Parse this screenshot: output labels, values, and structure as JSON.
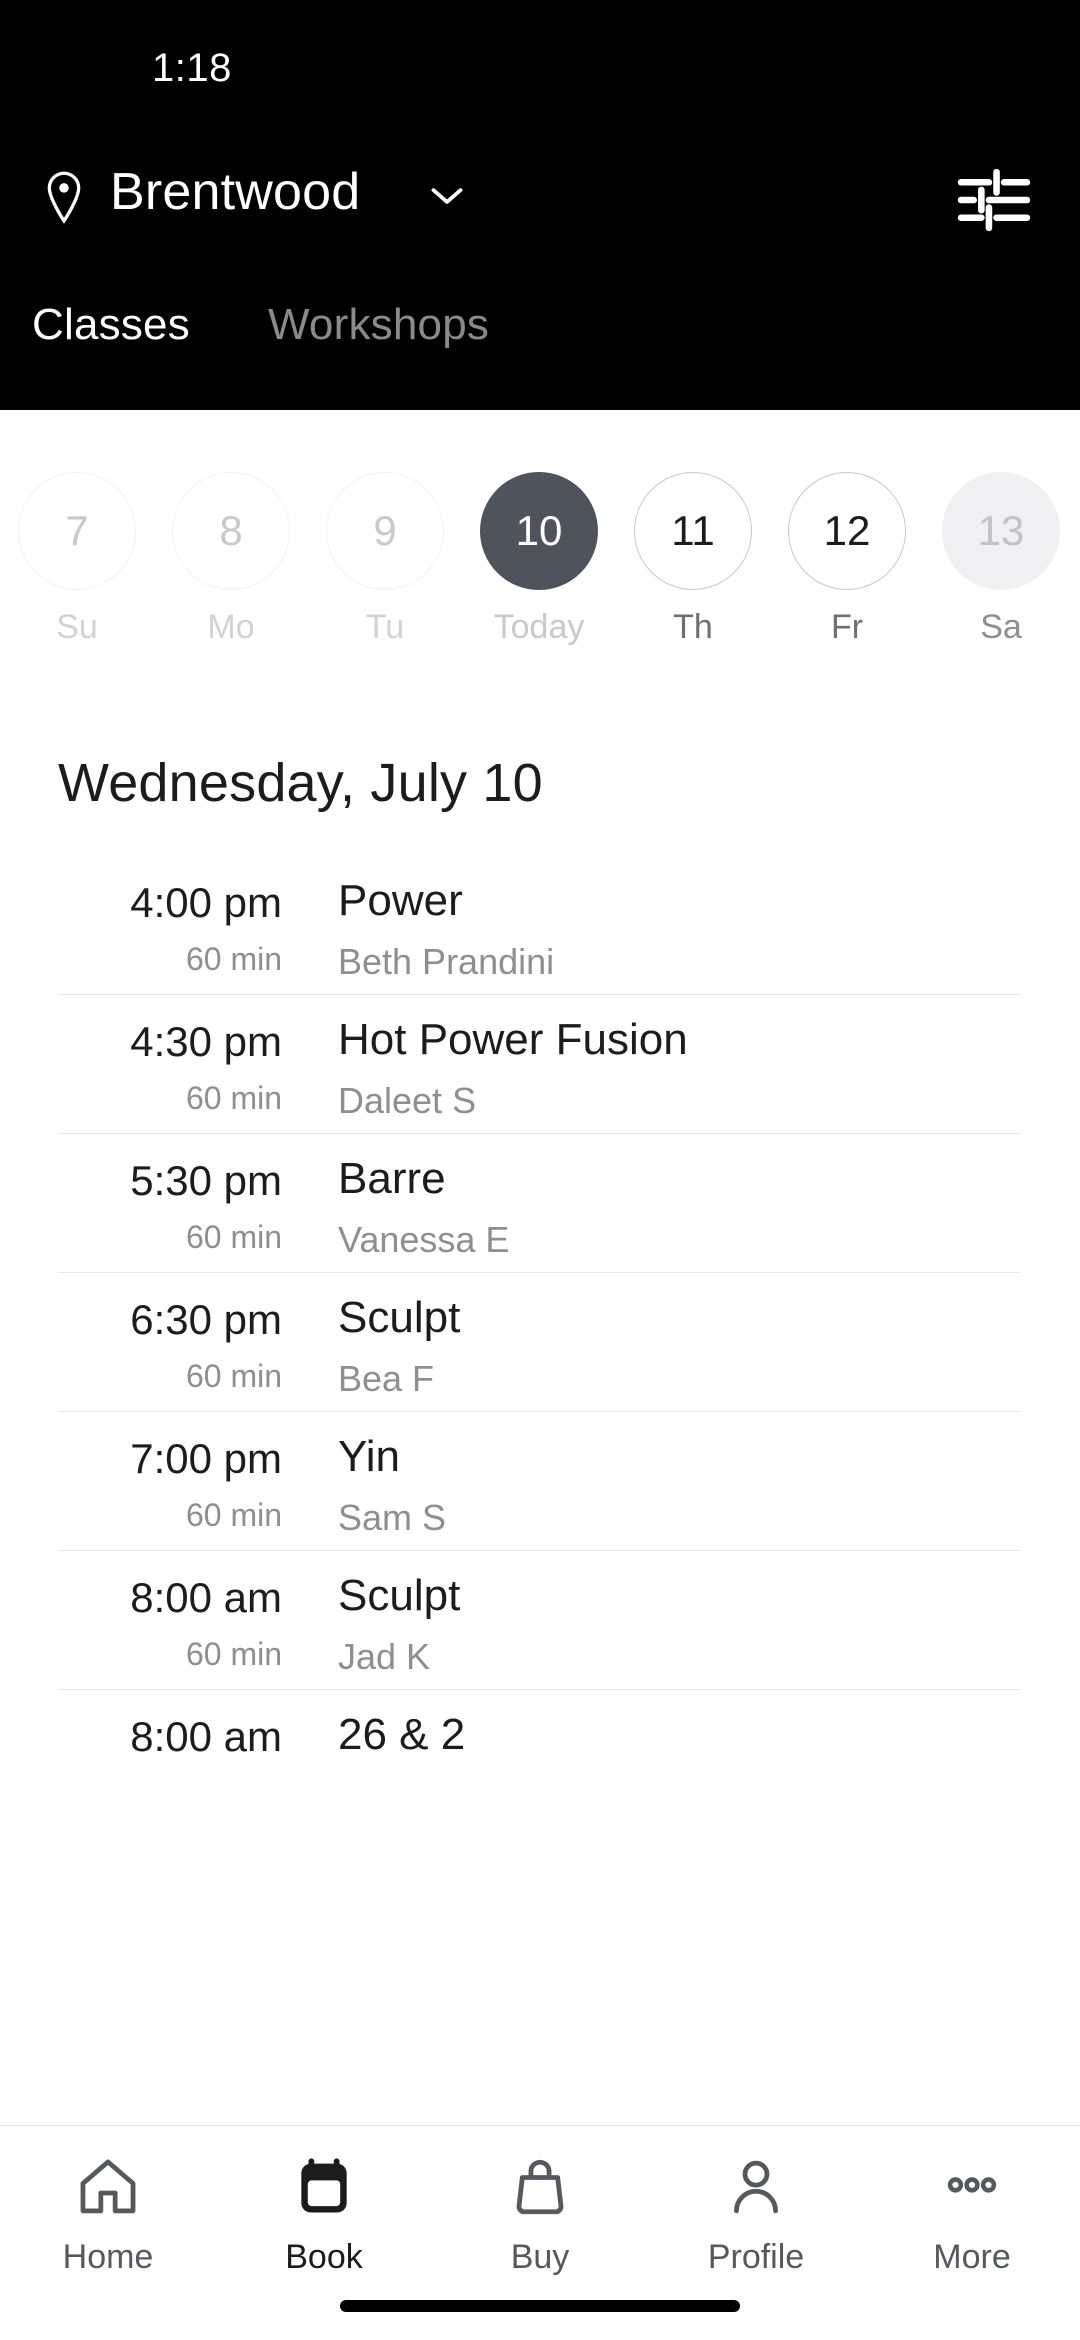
{
  "status_bar": {
    "time": "1:18"
  },
  "header": {
    "location": "Brentwood",
    "location_pin_icon": "location-pin-icon",
    "chevron_icon": "chevron-down-icon",
    "filter_icon": "filter-sliders-icon",
    "background_color": "#000000",
    "tabs": [
      {
        "label": "Classes",
        "active": true
      },
      {
        "label": "Workshops",
        "active": false
      }
    ]
  },
  "date_strip": {
    "days": [
      {
        "num": "7",
        "dow": "Su",
        "state": "past"
      },
      {
        "num": "8",
        "dow": "Mo",
        "state": "past"
      },
      {
        "num": "9",
        "dow": "Tu",
        "state": "past"
      },
      {
        "num": "10",
        "dow": "Today",
        "state": "today"
      },
      {
        "num": "11",
        "dow": "Th",
        "state": "future"
      },
      {
        "num": "12",
        "dow": "Fr",
        "state": "future"
      },
      {
        "num": "13",
        "dow": "Sa",
        "state": "filled"
      }
    ],
    "selected_color": "#4f535c"
  },
  "schedule": {
    "day_heading": "Wednesday, July 10",
    "classes": [
      {
        "time": "4:00 pm",
        "duration": "60 min",
        "name": "Power",
        "instructor": "Beth Prandini"
      },
      {
        "time": "4:30 pm",
        "duration": "60 min",
        "name": "Hot Power Fusion",
        "instructor": "Daleet S"
      },
      {
        "time": "5:30 pm",
        "duration": "60 min",
        "name": "Barre",
        "instructor": "Vanessa E"
      },
      {
        "time": "6:30 pm",
        "duration": "60 min",
        "name": "Sculpt",
        "instructor": "Bea F"
      },
      {
        "time": "7:00 pm",
        "duration": "60 min",
        "name": "Yin",
        "instructor": "Sam S"
      },
      {
        "time": "8:00 am",
        "duration": "60 min",
        "name": "Sculpt",
        "instructor": "Jad K"
      },
      {
        "time": "8:00 am",
        "duration": "",
        "name": "26 & 2",
        "instructor": ""
      }
    ]
  },
  "bottom_nav": {
    "items": [
      {
        "label": "Home",
        "icon": "home-icon",
        "active": false
      },
      {
        "label": "Book",
        "icon": "calendar-icon",
        "active": true
      },
      {
        "label": "Buy",
        "icon": "bag-icon",
        "active": false
      },
      {
        "label": "Profile",
        "icon": "person-icon",
        "active": false
      },
      {
        "label": "More",
        "icon": "ellipsis-icon",
        "active": false
      }
    ]
  }
}
